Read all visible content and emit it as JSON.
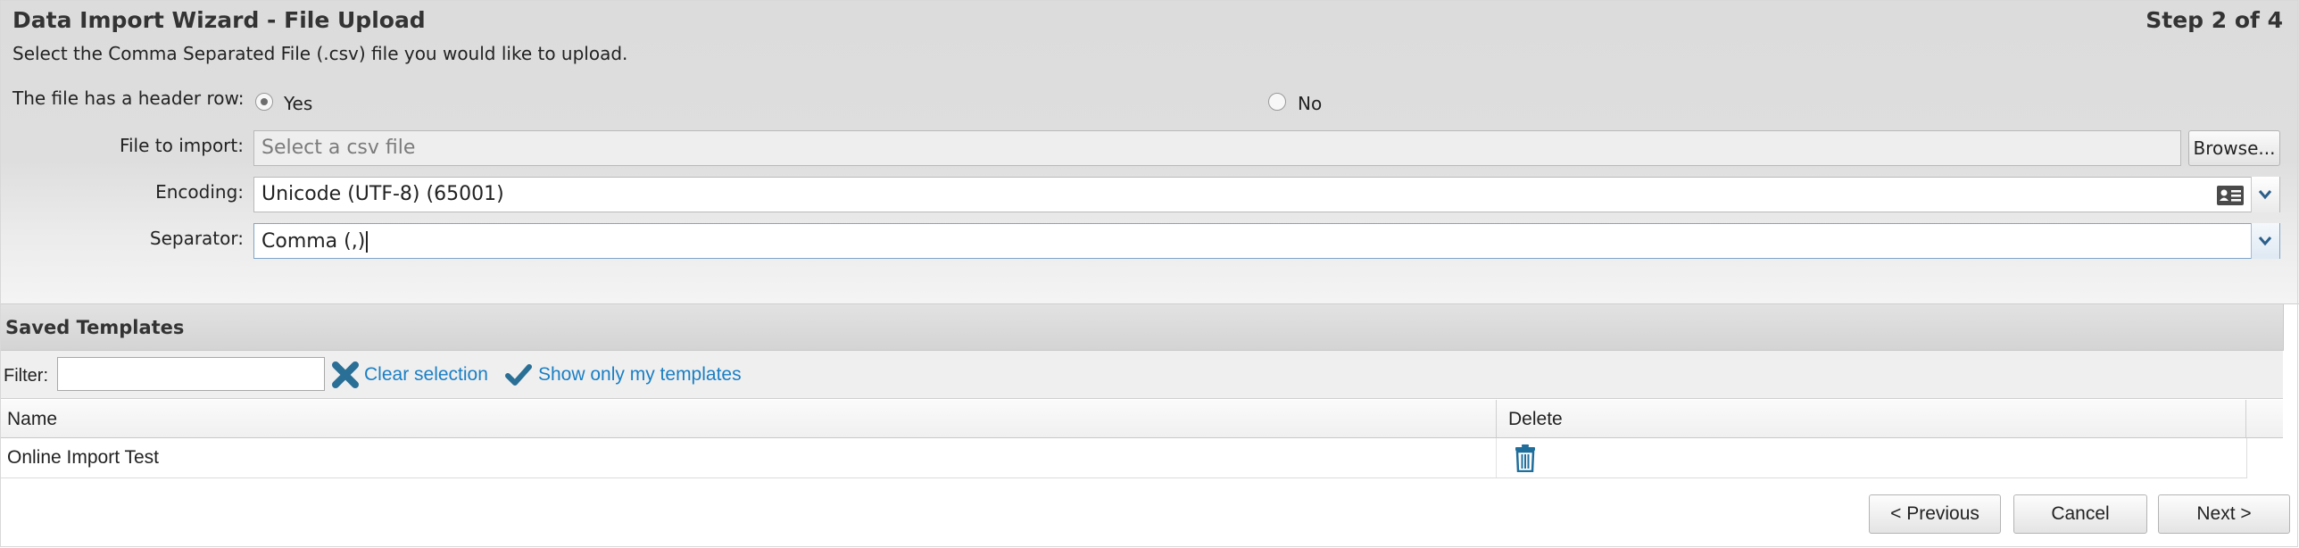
{
  "header": {
    "title": "Data Import Wizard - File Upload",
    "step": "Step 2 of 4",
    "subtitle": "Select the Comma Separated File (.csv) file you would like to upload."
  },
  "form": {
    "header_row_label": "The file has a header row:",
    "header_row_options": [
      {
        "label": "Yes",
        "checked": true
      },
      {
        "label": "No",
        "checked": false
      }
    ],
    "file_label": "File to import:",
    "file_placeholder": "Select a csv file",
    "browse_label": "Browse...",
    "encoding_label": "Encoding:",
    "encoding_value": "Unicode (UTF-8) (65001)",
    "encoding_icon": "id-card-icon",
    "separator_label": "Separator:",
    "separator_value": "Comma (,)"
  },
  "templates": {
    "section_title": "Saved Templates",
    "filter_label": "Filter:",
    "filter_value": "",
    "clear_selection": "Clear selection",
    "show_mine": "Show only my templates",
    "columns": [
      "Name",
      "Delete"
    ],
    "rows": [
      {
        "name": "Online Import Test",
        "delete_icon": "trash-icon"
      }
    ]
  },
  "footer": {
    "previous": "< Previous",
    "cancel": "Cancel",
    "next": "Next >"
  },
  "colors": {
    "link": "#1a7fc4",
    "clear_icon": "#2a6f96",
    "check_icon": "#2a6f96",
    "trash_icon": "#1f6e9c"
  }
}
